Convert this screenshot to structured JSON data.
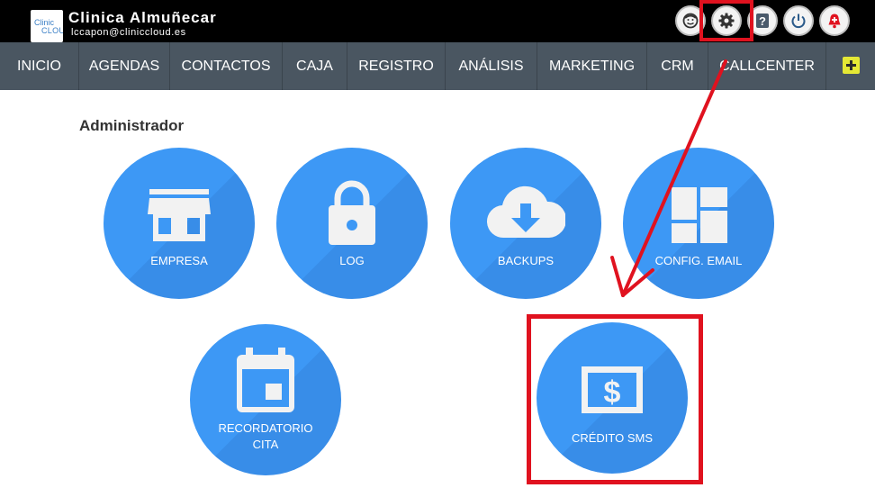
{
  "header": {
    "logo_line1": "Clinic",
    "logo_line2": "CLOUD",
    "clinic_name": "Clinica Almuñecar",
    "email": "lccapon@cliniccloud.es",
    "buttons": [
      "user-icon",
      "gear-icon",
      "help-icon",
      "power-icon",
      "alert-bell-icon"
    ]
  },
  "nav": {
    "items": [
      "INICIO",
      "AGENDAS",
      "CONTACTOS",
      "CAJA",
      "REGISTRO",
      "ANÁLISIS",
      "MARKETING",
      "CRM",
      "CALLCENTER"
    ],
    "more_icon": "plus-icon"
  },
  "section_title": "Administrador",
  "tiles": [
    {
      "label": "EMPRESA",
      "icon": "store-icon"
    },
    {
      "label": "LOG",
      "icon": "lock-icon"
    },
    {
      "label": "BACKUPS",
      "icon": "cloud-download-icon"
    },
    {
      "label": "CONFIG. EMAIL",
      "icon": "dashboard-icon"
    },
    {
      "label": "RECORDATORIO",
      "label2": "CITA",
      "icon": "calendar-icon"
    },
    {
      "label": "CRÉDITO SMS",
      "icon": "money-icon"
    }
  ],
  "colors": {
    "header_bg": "#000000",
    "nav_bg": "#4a5661",
    "tile_blue": "#3d98f5",
    "highlight_red": "#e0121f",
    "plus_yellow": "#e5e835"
  }
}
